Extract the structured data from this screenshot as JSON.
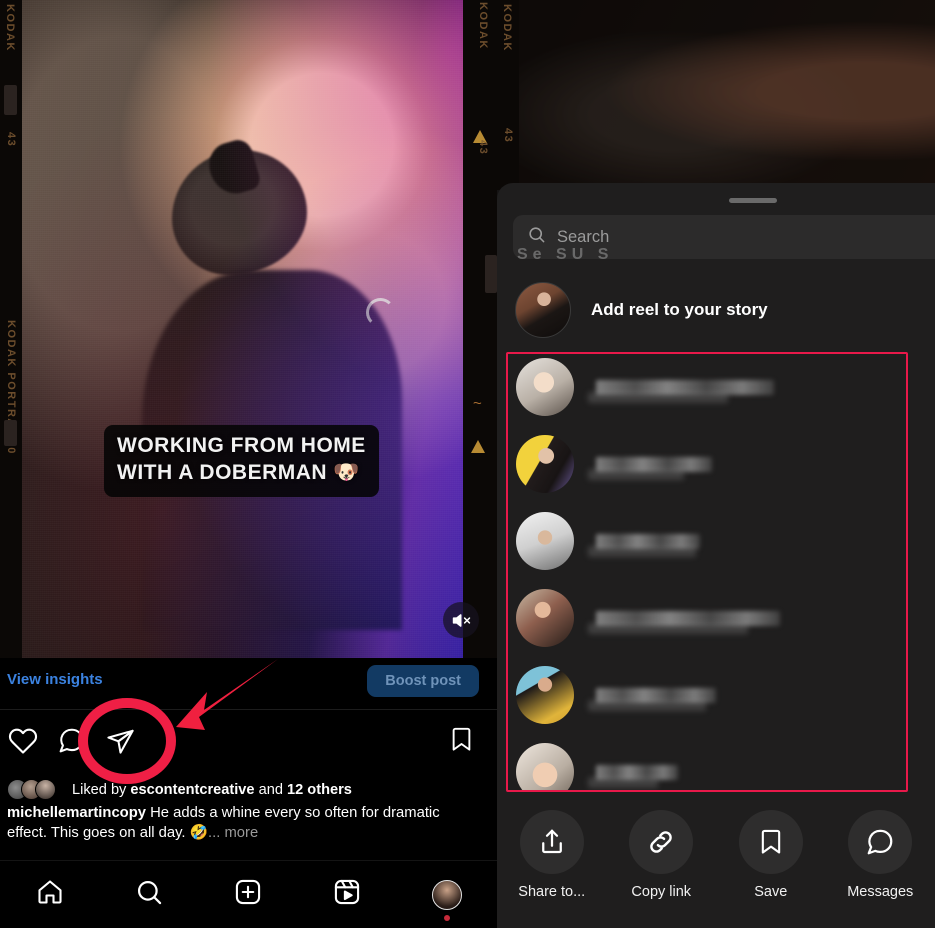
{
  "post": {
    "video_caption_line1": "WORKING FROM HOME",
    "video_caption_line2": "WITH A DOBERMAN 🐶",
    "film_brand_left": "KODAK PORTRA 400",
    "film_brand_right": "KODAK",
    "film_frame_number": "43",
    "view_insights_label": "View insights",
    "boost_post_label": "Boost post",
    "liked_by_prefix": "Liked by",
    "liked_by_user": "escontentcreative",
    "liked_by_middle": "and",
    "liked_by_others": "12 others",
    "caption_username": "michellemartincopy",
    "caption_text": "He adds a whine every so often for dramatic effect. This goes on all day. 🤣",
    "caption_more": "... more",
    "actions": [
      {
        "name": "like-icon",
        "label": "Like"
      },
      {
        "name": "comment-icon",
        "label": "Comment"
      },
      {
        "name": "share-icon",
        "label": "Share"
      },
      {
        "name": "save-icon",
        "label": "Save"
      }
    ],
    "mute_icon": "speaker-muted-icon",
    "spinner": "loading-spinner"
  },
  "bottom_nav": [
    {
      "name": "nav-home",
      "icon": "home-icon"
    },
    {
      "name": "nav-search",
      "icon": "search-icon"
    },
    {
      "name": "nav-create",
      "icon": "plus-square-icon"
    },
    {
      "name": "nav-reels",
      "icon": "reels-icon"
    },
    {
      "name": "nav-profile",
      "icon": "avatar-icon"
    }
  ],
  "share_sheet": {
    "drag_handle": "drag-handle",
    "search_placeholder": "Search",
    "search_value": "",
    "search_ghost_text": "Se SU S",
    "add_to_story_label": "Add reel to your story",
    "contacts": [
      {
        "id": 1,
        "name_width": 178,
        "name2_width": 140,
        "avatar": "group-selfie-avatar"
      },
      {
        "id": 2,
        "name_width": 116,
        "name2_width": 96,
        "avatar": "woman-yellow-bg-avatar"
      },
      {
        "id": 3,
        "name_width": 104,
        "name2_width": 108,
        "avatar": "man-white-hoodie-avatar"
      },
      {
        "id": 4,
        "name_width": 184,
        "name2_width": 160,
        "avatar": "mother-child-avatar"
      },
      {
        "id": 5,
        "name_width": 120,
        "name2_width": 118,
        "avatar": "woman-black-tee-avatar"
      },
      {
        "id": 6,
        "name_width": 82,
        "name2_width": 70,
        "avatar": "child-hoodie-avatar"
      }
    ],
    "actions": [
      {
        "name": "share-to-button",
        "icon": "share-arrow-up-icon",
        "label": "Share to..."
      },
      {
        "name": "copy-link-button",
        "icon": "link-icon",
        "label": "Copy link"
      },
      {
        "name": "save-button",
        "icon": "bookmark-icon",
        "label": "Save"
      },
      {
        "name": "messages-button",
        "icon": "message-bubble-icon",
        "label": "Messages"
      }
    ]
  },
  "annotations": {
    "circle_color": "#ef1f45",
    "arrow_color": "#f0203f",
    "box_color": "#e8194a",
    "circle_target": "share-icon",
    "box_target": "contacts-list"
  }
}
